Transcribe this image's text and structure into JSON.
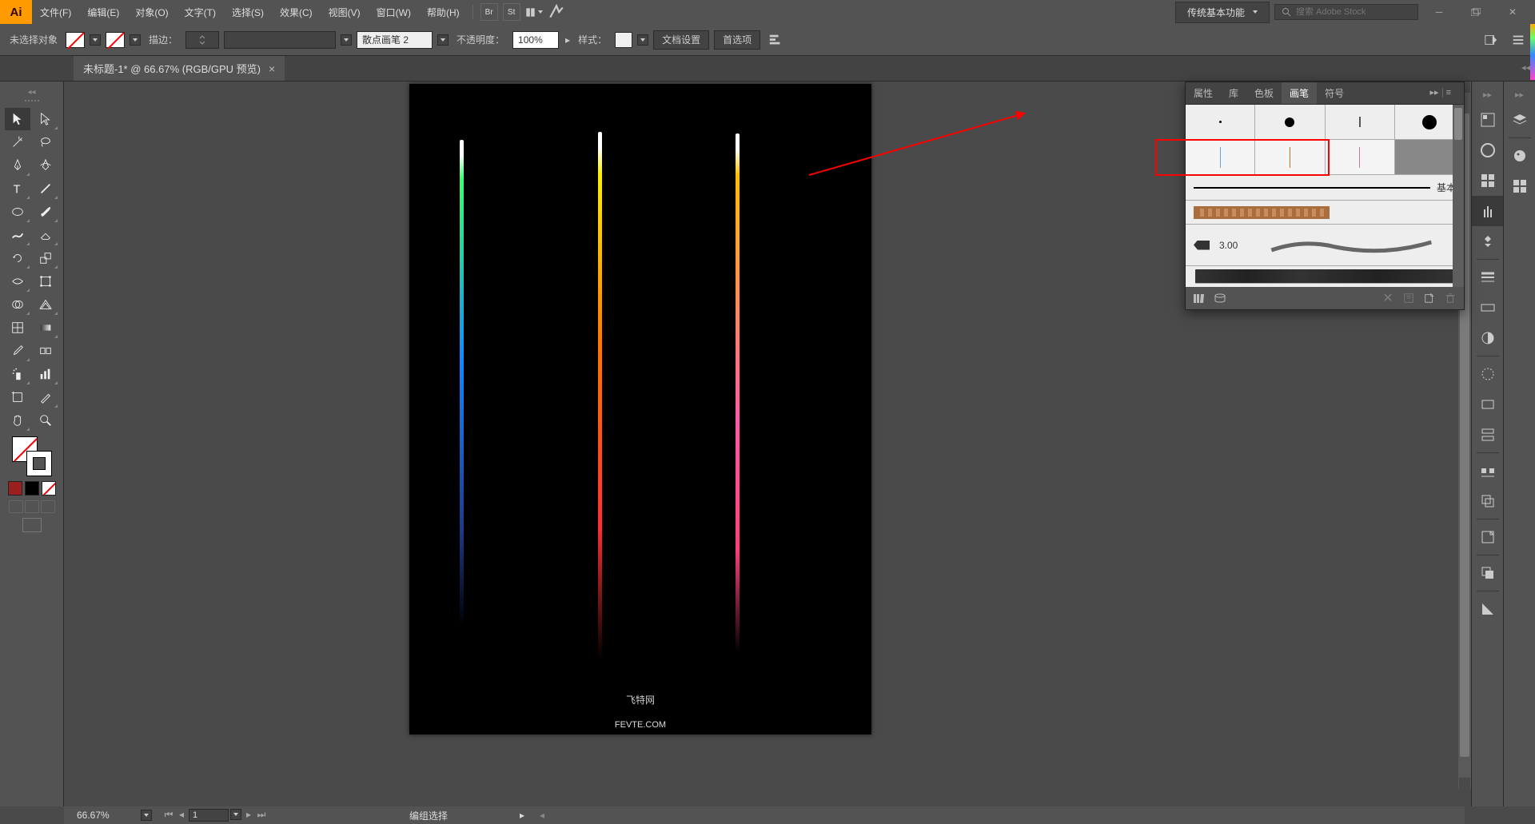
{
  "menu": {
    "items": [
      "文件(F)",
      "编辑(E)",
      "对象(O)",
      "文字(T)",
      "选择(S)",
      "效果(C)",
      "视图(V)",
      "窗口(W)",
      "帮助(H)"
    ],
    "workspace": "传统基本功能",
    "search_placeholder": "搜索 Adobe Stock",
    "br": "Br",
    "st": "St"
  },
  "control": {
    "selection": "未选择对象",
    "stroke_label": "描边：",
    "brush_name": "散点画笔 2",
    "opacity_label": "不透明度：",
    "opacity_value": "100%",
    "style_label": "样式：",
    "doc_setup": "文档设置",
    "prefs": "首选项"
  },
  "tab": {
    "title": "未标题-1* @ 66.67% (RGB/GPU 预览)"
  },
  "canvas": {
    "zoom": "66.67%",
    "page": "1",
    "watermark1": "飞特网",
    "watermark2": "FEVTE.COM"
  },
  "panel": {
    "tabs": [
      "属性",
      "库",
      "色板",
      "画笔",
      "符号"
    ],
    "basic": "基本",
    "cal_value": "3.00"
  },
  "status": {
    "mode": "编组选择"
  }
}
